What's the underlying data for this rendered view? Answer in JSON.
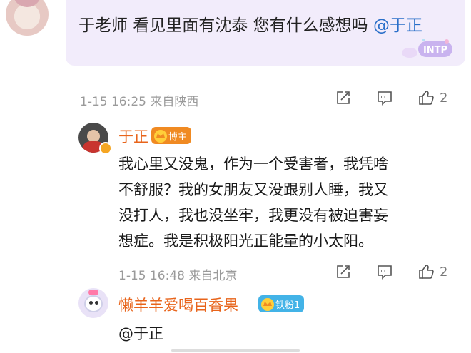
{
  "comment_top": {
    "text": "于老师  看见里面有沈泰 您有什么感想吗",
    "mention": "@于正",
    "sticker_text": "INTP",
    "meta": "1-15 16:25 来自陕西",
    "likes": "2"
  },
  "reply_author": {
    "name": "于正",
    "badge": "博主",
    "text_lines": [
      "我心里又没鬼，作为一个受害者，我凭啥",
      "不舒服？我的女朋友又没跟别人睡，我又",
      "没打人，我也没坐牢，我更没有被迫害妄",
      "想症。我是积极阳光正能量的小太阳。"
    ],
    "meta": "1-15 16:48 来自北京",
    "likes": "2"
  },
  "reply_fan": {
    "name": "懒羊羊爱喝百香果",
    "badge": "铁粉1",
    "text": "@于正"
  },
  "icons": [
    "share-icon",
    "comment-icon",
    "like-icon",
    "crown-icon",
    "verified-icon"
  ],
  "colors": {
    "username": "#e8641b",
    "mention": "#2a6fc9",
    "bubble_bg": "#f2ecfb",
    "host_badge": "#f08a22",
    "fan_badge": "#43b3e7"
  }
}
